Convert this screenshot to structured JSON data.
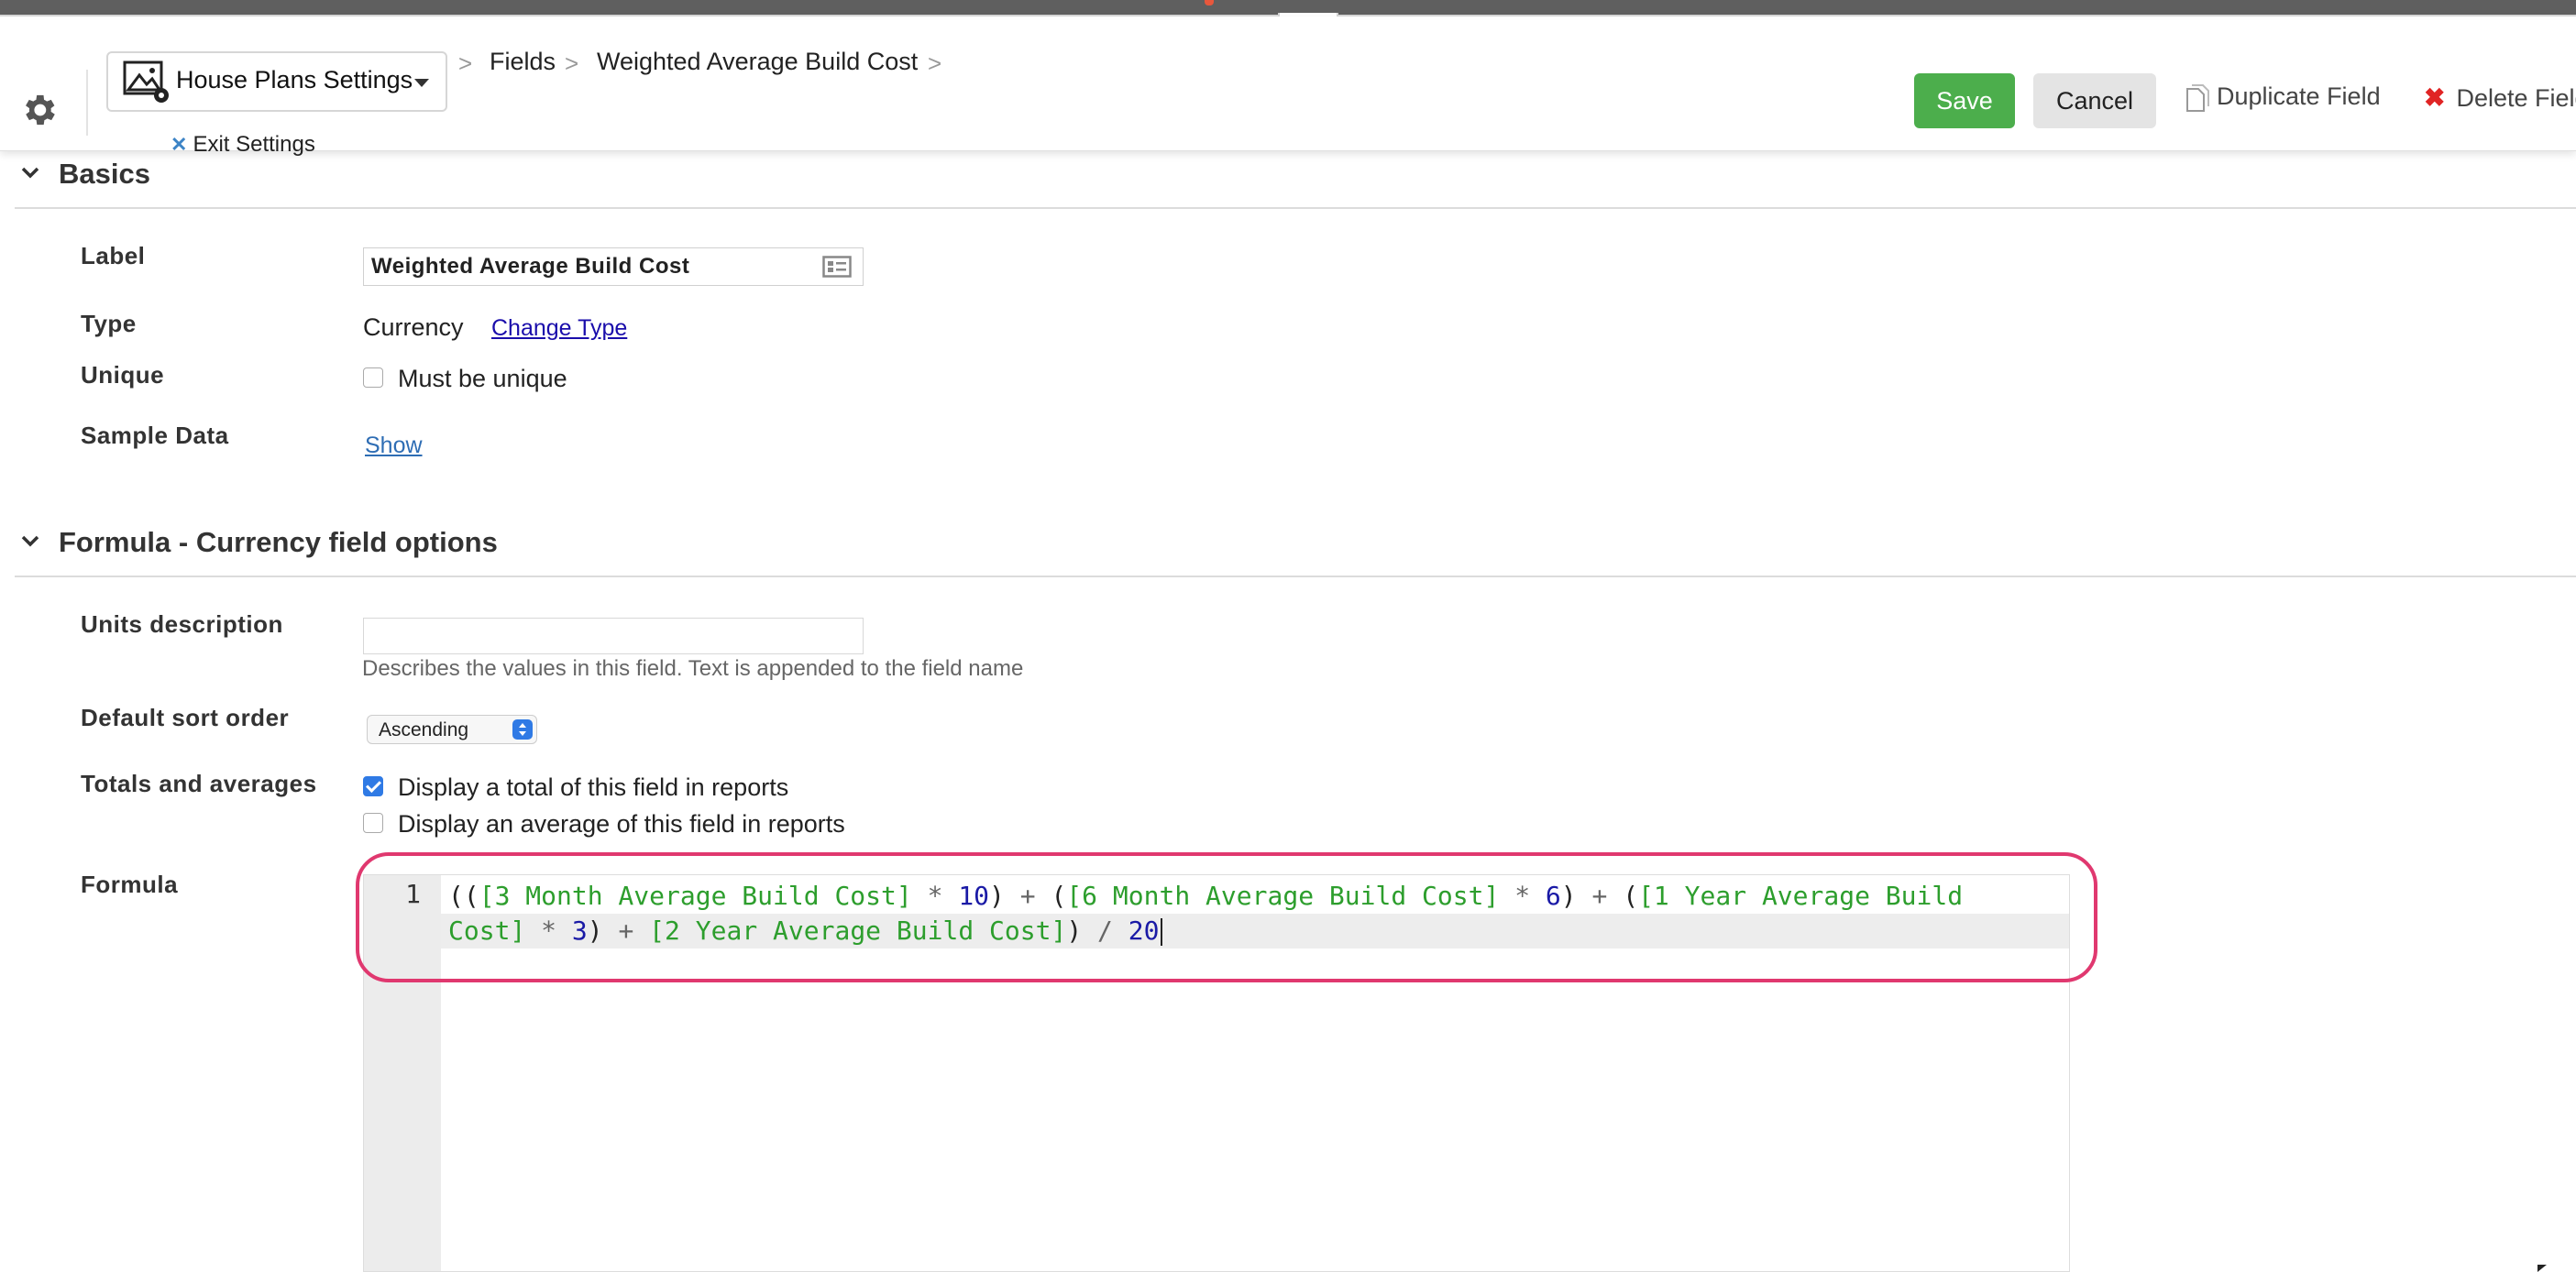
{
  "header": {
    "app_name": "House Plans Settings",
    "breadcrumbs": [
      "Fields",
      "Weighted Average Build Cost"
    ],
    "exit_label": "Exit Settings",
    "actions": {
      "save": "Save",
      "cancel": "Cancel",
      "duplicate": "Duplicate Field",
      "delete": "Delete Field"
    }
  },
  "basics": {
    "title": "Basics",
    "label_label": "Label",
    "label_value": "Weighted Average Build Cost",
    "type_label": "Type",
    "type_value": "Currency",
    "change_type": "Change Type",
    "unique_label": "Unique",
    "unique_option": "Must be unique",
    "unique_checked": false,
    "sample_label": "Sample Data",
    "sample_link": "Show"
  },
  "formula_section": {
    "title": "Formula - Currency field options",
    "units_label": "Units description",
    "units_value": "",
    "units_help": "Describes the values in this field. Text is appended to the field name",
    "sort_label": "Default sort order",
    "sort_value": "Ascending",
    "totals_label": "Totals and averages",
    "total_option": "Display a total of this field in reports",
    "total_checked": true,
    "average_option": "Display an average of this field in reports",
    "average_checked": false,
    "formula_label": "Formula",
    "line_number": "1",
    "formula_text": "(([3 Month Average Build Cost] * 10) + ([6 Month Average Build Cost] * 6) + ([1 Year Average Build Cost] * 3) + [2 Year Average Build Cost]) / 20",
    "formula_tokens": [
      {
        "t": "((",
        "k": "plain"
      },
      {
        "t": "[3 Month Average Build Cost]",
        "k": "fld"
      },
      {
        "t": " * ",
        "k": "op"
      },
      {
        "t": "10",
        "k": "num"
      },
      {
        "t": ") ",
        "k": "plain"
      },
      {
        "t": "+",
        "k": "op"
      },
      {
        "t": " (",
        "k": "plain"
      },
      {
        "t": "[6 Month Average Build Cost]",
        "k": "fld"
      },
      {
        "t": " * ",
        "k": "op"
      },
      {
        "t": "6",
        "k": "num"
      },
      {
        "t": ") ",
        "k": "plain"
      },
      {
        "t": "+",
        "k": "op"
      },
      {
        "t": " (",
        "k": "plain"
      },
      {
        "t": "[1 Year Average Build Cost]",
        "k": "fld"
      },
      {
        "t": " * ",
        "k": "op"
      },
      {
        "t": "3",
        "k": "num"
      },
      {
        "t": ") ",
        "k": "plain"
      },
      {
        "t": "+",
        "k": "op"
      },
      {
        "t": " ",
        "k": "plain"
      },
      {
        "t": "[2 Year Average Build Cost]",
        "k": "fld"
      },
      {
        "t": ") ",
        "k": "plain"
      },
      {
        "t": "/",
        "k": "op"
      },
      {
        "t": " ",
        "k": "plain"
      },
      {
        "t": "20",
        "k": "num"
      }
    ]
  },
  "colors": {
    "save": "#4cae4c",
    "delete_icon": "#e02424",
    "highlight": "#e0386f",
    "field_token": "#2d9e2d",
    "number_token": "#1a1aa6"
  },
  "icons": [
    "up-arrow-icon",
    "gear-icon",
    "app-settings-icon",
    "caret-down-icon",
    "close-icon",
    "document-icon",
    "delete-x-icon",
    "card-icon",
    "chevron-down-icon",
    "select-stepper-icon"
  ]
}
